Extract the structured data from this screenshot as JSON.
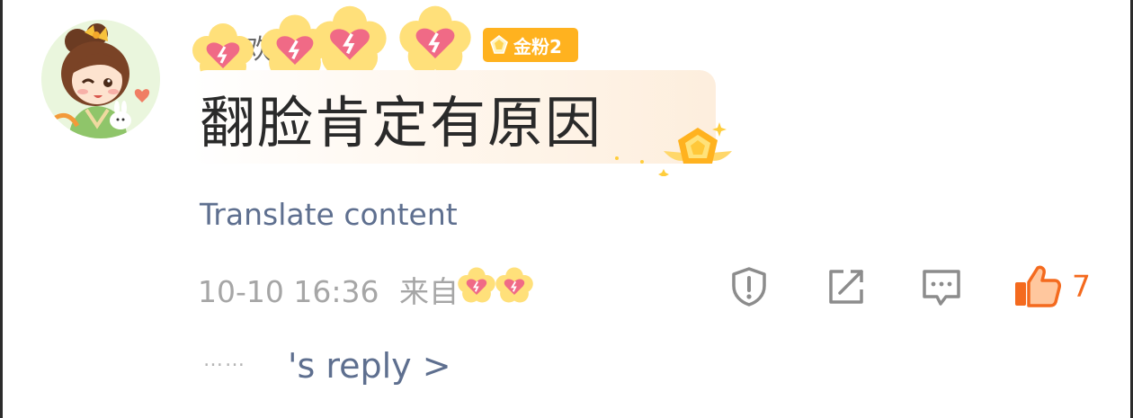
{
  "comment": {
    "username_fragment": "欢 于 八",
    "fan_badge": {
      "label": "金粉2",
      "color": "#ffb21f"
    },
    "text": "翻脸肯定有原因",
    "translate_label": "Translate content",
    "meta": {
      "date": "10-10 16:36",
      "source_prefix": "来自"
    },
    "actions": {
      "report_icon": "shield-exclamation-icon",
      "repost_icon": "share-arrow-icon",
      "comment_icon": "comment-icon",
      "like_icon": "thumbs-up-icon",
      "like_count": "7",
      "like_color": "#f46a1e"
    },
    "reply": {
      "dots": "……",
      "label": "'s reply >"
    }
  },
  "colors": {
    "link": "#5e6f8f",
    "meta_text": "#a6a6a6",
    "sticker_flower": "#ffe07a",
    "sticker_heart": "#f06a86"
  }
}
